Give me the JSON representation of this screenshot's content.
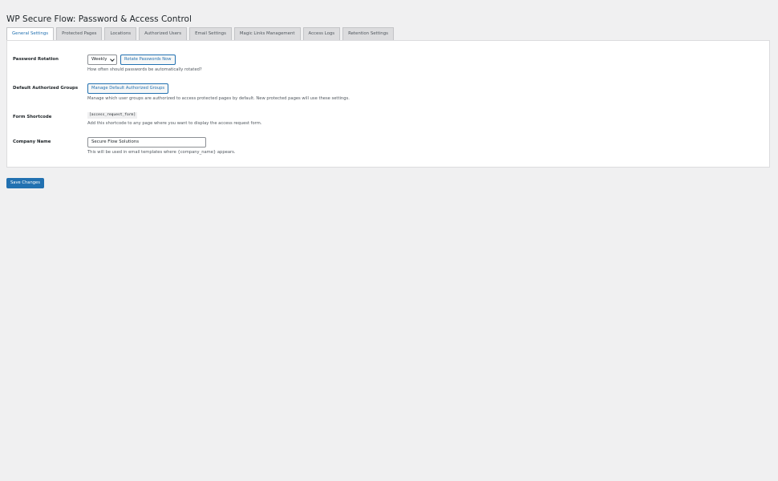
{
  "page": {
    "title": "WP Secure Flow: Password & Access Control"
  },
  "tabs": [
    {
      "label": "General Settings",
      "active": true
    },
    {
      "label": "Protected Pages",
      "active": false
    },
    {
      "label": "Locations",
      "active": false
    },
    {
      "label": "Authorized Users",
      "active": false
    },
    {
      "label": "Email Settings",
      "active": false
    },
    {
      "label": "Magic Links Management",
      "active": false
    },
    {
      "label": "Access Logs",
      "active": false
    },
    {
      "label": "Retention Settings",
      "active": false
    }
  ],
  "settings": {
    "password_rotation": {
      "label": "Password Rotation",
      "select_value": "Weekly",
      "button_label": "Rotate Passwords Now",
      "description": "How often should passwords be automatically rotated?"
    },
    "default_groups": {
      "label": "Default Authorized Groups",
      "button_label": "Manage Default Authorized Groups",
      "description": "Manage which user groups are authorized to access protected pages by default. New protected pages will use these settings."
    },
    "form_shortcode": {
      "label": "Form Shortcode",
      "code": "[access_request_form]",
      "description": "Add this shortcode to any page where you want to display the access request form."
    },
    "company_name": {
      "label": "Company Name",
      "value": "Secure Flow Solutions",
      "description": "This will be used in email templates where {company_name} appears."
    }
  },
  "actions": {
    "save_label": "Save Changes"
  },
  "colors": {
    "accent": "#2271b1",
    "background": "#f0f0f1",
    "panel": "#ffffff"
  }
}
